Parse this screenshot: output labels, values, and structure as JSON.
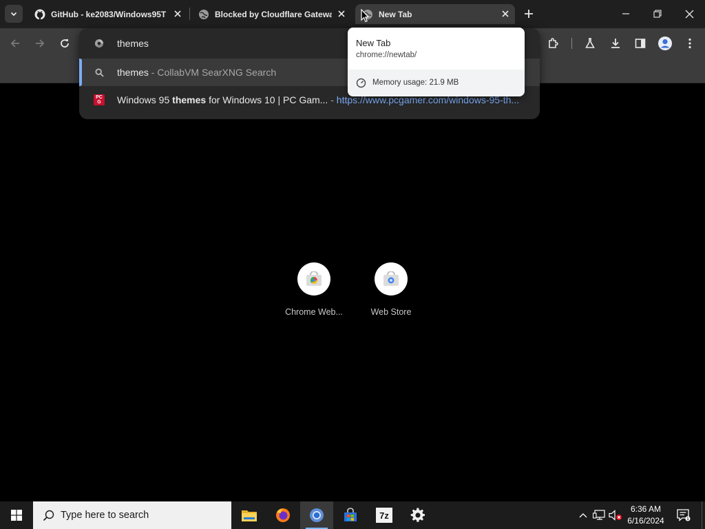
{
  "browser": {
    "tabs": [
      {
        "title": "GitHub - ke2083/Windows95T",
        "favicon": "github-icon",
        "active": false
      },
      {
        "title": "Blocked by Cloudflare Gateway",
        "favicon": "globe-icon",
        "active": false
      },
      {
        "title": "New Tab",
        "favicon": "globe-icon",
        "active": true
      }
    ],
    "new_tab_label": "+",
    "omnibox": {
      "input_value": "themes",
      "suggestions": [
        {
          "icon": "search-icon",
          "query": "themes",
          "separator": " - ",
          "engine": "CollabVM SearXNG Search",
          "selected": true
        },
        {
          "icon": "pcgamer-favicon",
          "title_before": "Windows 95 ",
          "title_bold": "themes",
          "title_after": " for Windows 10 | PC Gam...",
          "separator": " - ",
          "url": "https://www.pcgamer.com/windows-95-th...",
          "selected": false
        }
      ]
    },
    "hover_card": {
      "title": "New Tab",
      "url": "chrome://newtab/",
      "memory_label": "Memory usage: 21.9 MB"
    },
    "shortcuts": [
      {
        "label": "Chrome Web...",
        "icon": "chrome-web-store-icon"
      },
      {
        "label": "Web Store",
        "icon": "web-store-icon"
      }
    ]
  },
  "taskbar": {
    "search_placeholder": "Type here to search",
    "apps": [
      "file-explorer-icon",
      "firefox-icon",
      "chrome-icon",
      "microsoft-store-icon",
      "7zip-icon",
      "settings-icon"
    ],
    "sevenzip_label": "7z",
    "clock_time": "6:36 AM",
    "clock_date": "6/16/2024"
  },
  "colors": {
    "accent_blue": "#7cacf8",
    "tab_bg": "#1f1f1f",
    "toolbar_bg": "#3c3c3c",
    "taskbar_bg": "#1c1c1c"
  }
}
